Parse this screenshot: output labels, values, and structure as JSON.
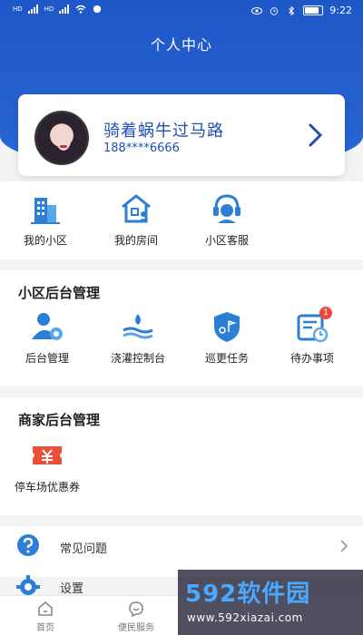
{
  "status_bar": {
    "left_labels": [
      "HD",
      "4G",
      "HD",
      "4G"
    ],
    "time": "9:22",
    "battery_icon": "battery-icon"
  },
  "header": {
    "title": "个人中心",
    "accent": "#1e57c8"
  },
  "profile": {
    "name": "骑着蜗牛过马路",
    "phone": "188****6666"
  },
  "quick_menu": [
    {
      "label": "我的小区",
      "icon": "building-icon"
    },
    {
      "label": "我的房间",
      "icon": "house-user-icon"
    },
    {
      "label": "小区客服",
      "icon": "headset-icon"
    }
  ],
  "community_admin": {
    "title": "小区后台管理",
    "items": [
      {
        "label": "后台管理",
        "icon": "user-gear-icon"
      },
      {
        "label": "浇灌控制台",
        "icon": "water-icon"
      },
      {
        "label": "巡更任务",
        "icon": "patrol-shield-icon"
      },
      {
        "label": "待办事项",
        "icon": "todo-icon",
        "badge": "1"
      }
    ]
  },
  "merchant_admin": {
    "title": "商家后台管理",
    "items": [
      {
        "label": "停车场优惠券",
        "icon": "coupon-icon"
      }
    ]
  },
  "list": [
    {
      "label": "常见问题",
      "icon": "question-icon"
    },
    {
      "label": "设置",
      "icon": "gear-icon"
    }
  ],
  "tabs": [
    {
      "label": "首页",
      "icon": "home-icon"
    },
    {
      "label": "便民服务",
      "icon": "service-icon"
    }
  ],
  "watermark": {
    "brand": "592软件园",
    "url": "www.592xiazai.com"
  }
}
